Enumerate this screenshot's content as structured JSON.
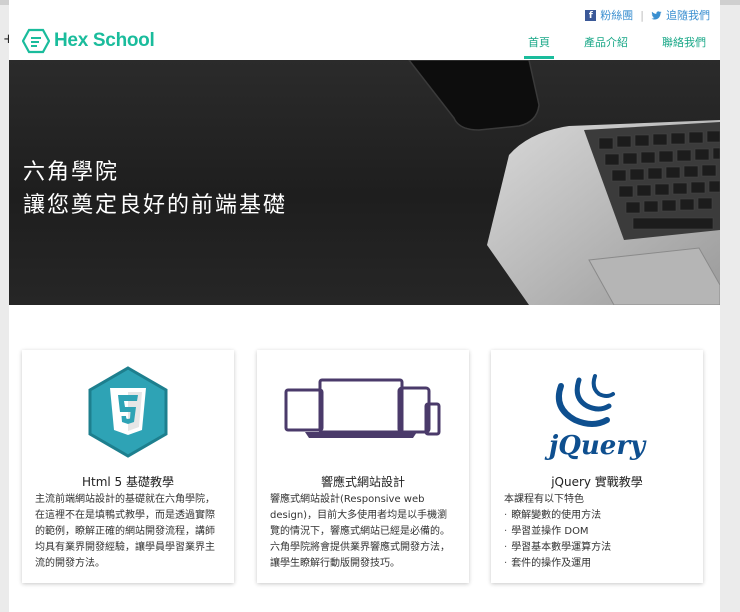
{
  "social": {
    "facebook_label": "粉絲團",
    "twitter_label": "追隨我們"
  },
  "brand": {
    "name": "Hex School"
  },
  "nav": {
    "items": [
      {
        "label": "首頁"
      },
      {
        "label": "產品介紹"
      },
      {
        "label": "聯絡我們"
      }
    ]
  },
  "hero": {
    "line1": "六角學院",
    "line2": "讓您奠定良好的前端基礎"
  },
  "cards": [
    {
      "title": "Html 5 基礎教學",
      "body": "主流前端網站設計的基礎就在六角學院，在這裡不在是填鴨式教學，而是透過實際的範例，瞭解正確的網站開發流程，講師均具有業界開發經驗，讓學員學習業界主流的開發方法。"
    },
    {
      "title": "響應式網站設計",
      "body": "響應式網站設計(Responsive web design)，目前大多使用者均是以手機瀏覽的情況下，響應式網站已經是必備的。六角學院將會提供業界響應式開發方法，讓學生瞭解行動版開發技巧。"
    },
    {
      "title": "jQuery 實戰教學",
      "intro": "本課程有以下特色",
      "list": [
        "瞭解變數的使用方法",
        "學習並操作 DOM",
        "學習基本數學運算方法",
        "套件的操作及運用"
      ]
    }
  ],
  "colors": {
    "brand": "#1abc9c",
    "link": "#3a8fd0",
    "hero_bg": "#222222",
    "jquery_blue": "#0e4f8f"
  }
}
